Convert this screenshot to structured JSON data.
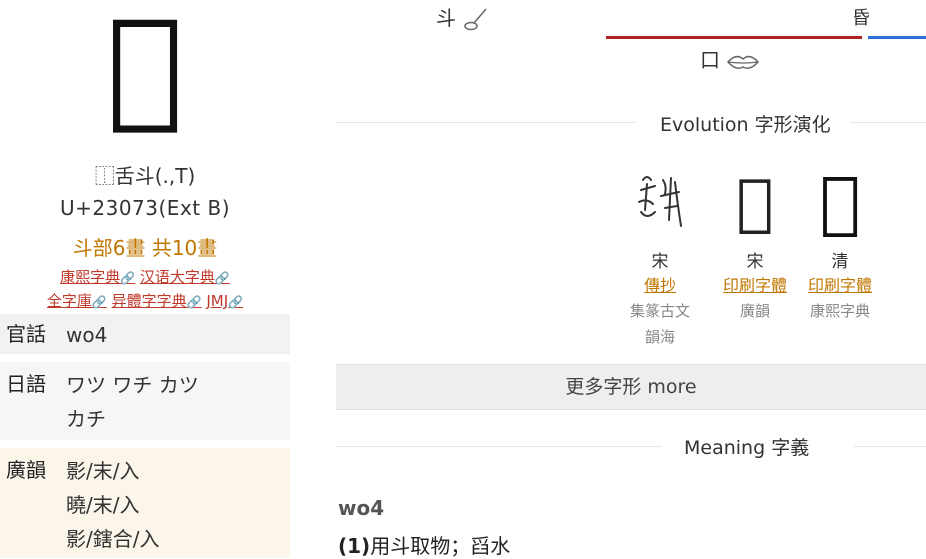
{
  "character": {
    "glyph": "𣂓"
  },
  "info": {
    "ids": "⿰舌斗(.,T)",
    "code": "U+23073(Ext B)",
    "radical": "斗部6畫 共10畫"
  },
  "dict_links": {
    "row1": [
      "康熙字典",
      "汉语大字典"
    ],
    "row2": [
      "全字庫",
      "异體字字典",
      "JMJ"
    ]
  },
  "readings": [
    {
      "label": "官話",
      "values": [
        "wo4"
      ]
    },
    {
      "label": "日語",
      "values": [
        "ワツ ワチ カツ",
        "カチ"
      ]
    },
    {
      "label": "廣韻",
      "values": [
        "影/末/入",
        "曉/末/入",
        "影/鎋合/入"
      ]
    }
  ],
  "components": {
    "word1": "斗",
    "word2": "昏",
    "word3": "口"
  },
  "evolution": {
    "title": "Evolution 字形演化",
    "columns": [
      {
        "era": "宋",
        "type": "傳抄",
        "sources": [
          "集篆古文",
          "韻海"
        ]
      },
      {
        "era": "宋",
        "type": "印刷字體",
        "sources": [
          "廣韻"
        ]
      },
      {
        "era": "清",
        "type": "印刷字體",
        "sources": [
          "康熙字典"
        ]
      }
    ]
  },
  "more_button": "更多字形 more",
  "meaning": {
    "title": "Meaning 字義",
    "heading": "wo4",
    "definition_num": "(1)",
    "definition": "用斗取物；舀水"
  },
  "icons": [
    "ladle-icon",
    "lips-icon",
    "external-link-icon"
  ],
  "colors": {
    "accent_orange": "#c07700",
    "link_red": "#c0392b",
    "tab_red": "#b22222",
    "tab_blue": "#2c6fd6"
  }
}
